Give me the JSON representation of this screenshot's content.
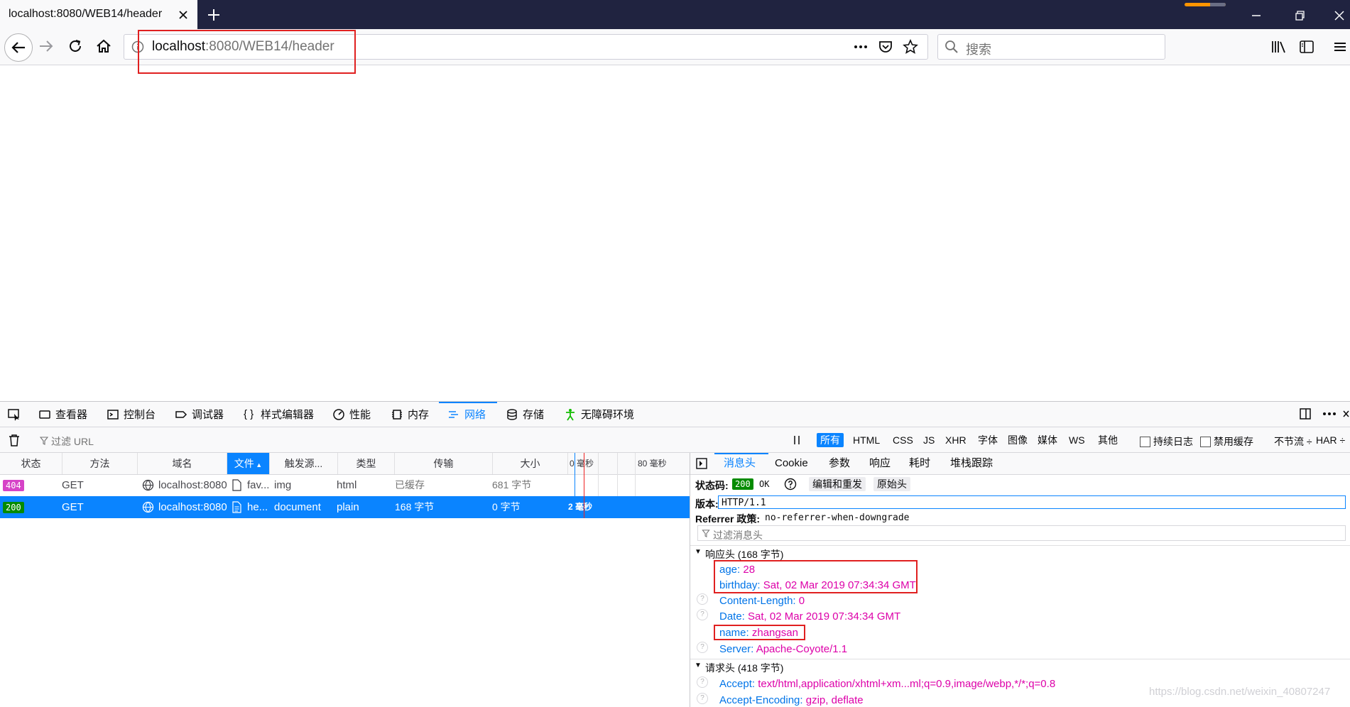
{
  "browser": {
    "tab_title": "localhost:8080/WEB14/header",
    "url_host": "localhost",
    "url_rest": ":8080/WEB14/header",
    "search_placeholder": "搜索"
  },
  "devtools": {
    "tabs": [
      "查看器",
      "控制台",
      "调试器",
      "样式编辑器",
      "性能",
      "内存",
      "网络",
      "存储",
      "无障碍环境"
    ],
    "active_tab": "网络",
    "network": {
      "filter_placeholder": "过滤 URL",
      "type_filters": [
        "所有",
        "HTML",
        "CSS",
        "JS",
        "XHR",
        "字体",
        "图像",
        "媒体",
        "WS",
        "其他"
      ],
      "persist_logs": "持续日志",
      "disable_cache": "禁用缓存",
      "throttle": "不节流 ÷",
      "har": "HAR ÷",
      "columns": [
        "状态",
        "方法",
        "域名",
        "文件",
        "触发源...",
        "类型",
        "传输",
        "大小",
        "0 毫秒",
        "80 毫秒"
      ],
      "requests": [
        {
          "status": "404",
          "method": "GET",
          "domain": "localhost:8080",
          "file": "fav...",
          "cause": "img",
          "type": "html",
          "transferred": "已缓存",
          "size": "681 字节",
          "timing": ""
        },
        {
          "status": "200",
          "method": "GET",
          "domain": "localhost:8080",
          "file": "he...",
          "cause": "document",
          "type": "plain",
          "transferred": "168 字节",
          "size": "0 字节",
          "timing": "2 毫秒"
        }
      ]
    },
    "details": {
      "tabs": [
        "消息头",
        "Cookie",
        "参数",
        "响应",
        "耗时",
        "堆栈跟踪"
      ],
      "status_label": "状态码:",
      "status_code": "200",
      "status_text": "OK",
      "edit_resend": "编辑和重发",
      "raw_headers": "原始头",
      "version_label": "版本:",
      "version": "HTTP/1.1",
      "referrer_label": "Referrer 政策:",
      "referrer": "no-referrer-when-downgrade",
      "filter_headers": "过滤消息头",
      "response_section": "响应头 (168 字节)",
      "response_headers": [
        {
          "name": "age:",
          "value": "28"
        },
        {
          "name": "birthday:",
          "value": "Sat, 02 Mar 2019 07:34:34 GMT"
        },
        {
          "name": "Content-Length:",
          "value": "0"
        },
        {
          "name": "Date:",
          "value": "Sat, 02 Mar 2019 07:34:34 GMT"
        },
        {
          "name": "name:",
          "value": "zhangsan"
        },
        {
          "name": "Server:",
          "value": "Apache-Coyote/1.1"
        }
      ],
      "request_section": "请求头 (418 字节)",
      "request_headers": [
        {
          "name": "Accept:",
          "value": "text/html,application/xhtml+xm...ml;q=0.9,image/webp,*/*;q=0.8"
        },
        {
          "name": "Accept-Encoding:",
          "value": "gzip, deflate"
        }
      ]
    }
  },
  "watermark": "https://blog.csdn.net/weixin_40807247",
  "colors": {
    "accent": "#0a84ff",
    "highlight": "#e02020",
    "header_value": "#dd00a9",
    "header_name": "#0074e8"
  }
}
